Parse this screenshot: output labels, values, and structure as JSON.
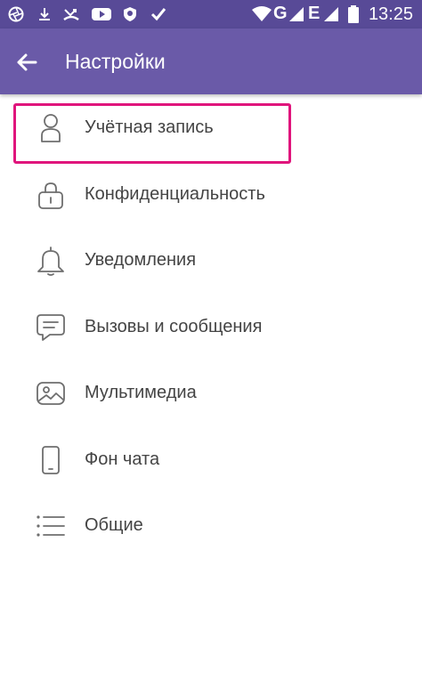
{
  "status_bar": {
    "time": "13:25",
    "left_icons": [
      "aperture-icon",
      "download-icon",
      "missed-call-icon",
      "youtube-icon",
      "shield-app-icon",
      "check-app-icon"
    ],
    "right_icons": [
      "wifi-icon",
      "signal-icon",
      "network-e-icon",
      "signal-2-icon",
      "battery-icon"
    ],
    "network_g": "G",
    "network_e": "E"
  },
  "app_bar": {
    "title": "Настройки",
    "background": "#6a5aa8"
  },
  "menu": {
    "items": [
      {
        "label": "Учётная запись",
        "icon": "user-icon"
      },
      {
        "label": "Конфиденциальность",
        "icon": "lock-icon"
      },
      {
        "label": "Уведомления",
        "icon": "bell-icon"
      },
      {
        "label": "Вызовы и сообщения",
        "icon": "chat-bubble-icon"
      },
      {
        "label": "Мультимедиа",
        "icon": "image-icon"
      },
      {
        "label": "Фон чата",
        "icon": "phone-icon"
      },
      {
        "label": "Общие",
        "icon": "list-icon"
      }
    ]
  },
  "highlight_color": "#e0157c"
}
